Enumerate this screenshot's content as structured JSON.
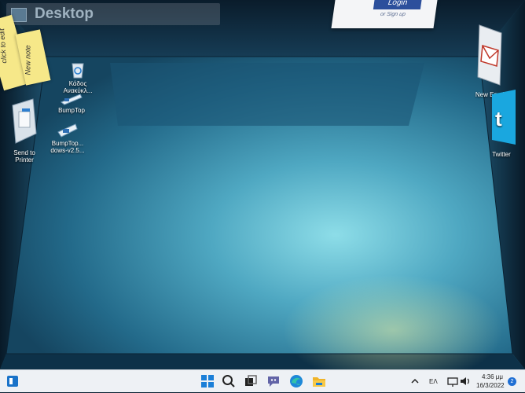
{
  "window": {
    "title": "Desktop"
  },
  "notes": [
    {
      "text": "click to edit"
    },
    {
      "text": "New note"
    }
  ],
  "login_card": {
    "button_label": "Login",
    "signup_text": "or Sign up"
  },
  "desktop_icons": [
    {
      "label": "Κάδος Ανακύκλ...",
      "icon": "recycle-bin-icon"
    },
    {
      "label": "BumpTop",
      "icon": "bumptop-icon"
    },
    {
      "label": "BumpTop... dows-v2.5...",
      "icon": "bumptop-installer-icon"
    },
    {
      "label": "Send to Printer",
      "icon": "printer-icon"
    },
    {
      "label": "New Email",
      "icon": "email-icon"
    },
    {
      "label": "Twitter",
      "icon": "twitter-icon"
    }
  ],
  "taskbar": {
    "apps": [
      "start-icon",
      "search-icon",
      "task-view-icon",
      "chat-icon",
      "edge-icon",
      "file-explorer-icon"
    ],
    "tray": {
      "language": "ΕΛ",
      "time": "4:36 μμ",
      "date": "16/3/2022",
      "notification_count": "2"
    }
  }
}
